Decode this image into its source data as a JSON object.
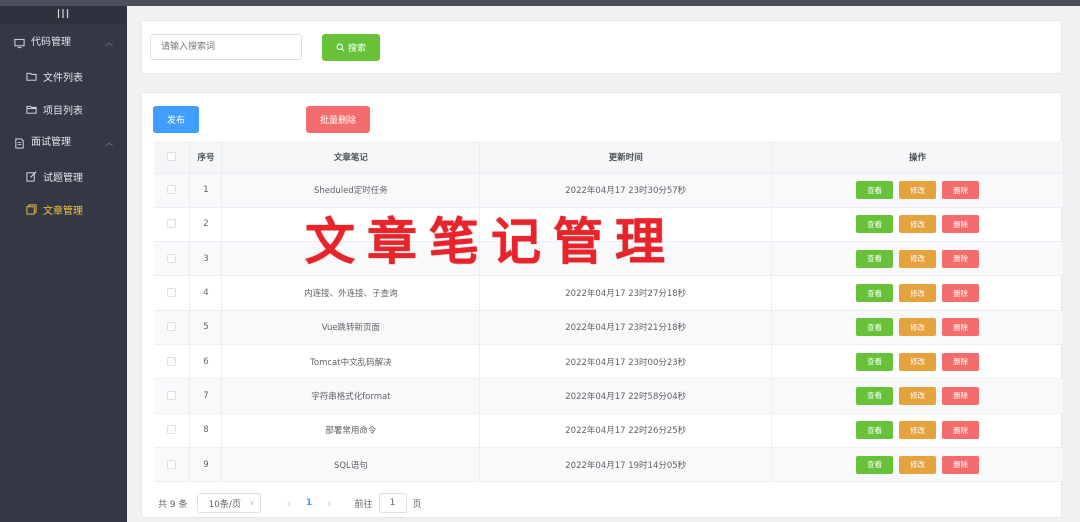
{
  "sidebar": {
    "toggle": "III",
    "groups": [
      {
        "label": "代码管理",
        "items": [
          {
            "label": "文件列表"
          },
          {
            "label": "项目列表"
          }
        ]
      },
      {
        "label": "面试管理",
        "items": [
          {
            "label": "试题管理"
          },
          {
            "label": "文章管理",
            "active": true
          }
        ]
      }
    ]
  },
  "search": {
    "placeholder": "请输入搜索词",
    "button_label": "搜索"
  },
  "toolbar": {
    "publish_label": "发布",
    "batch_delete_label": "批量删除"
  },
  "table": {
    "columns": [
      "序号",
      "文章笔记",
      "更新时间",
      "操作"
    ],
    "rows": [
      {
        "no": "1",
        "title": "Sheduled定时任务",
        "time": "2022年04月17 23时30分57秒"
      },
      {
        "no": "2",
        "title": "",
        "time": ""
      },
      {
        "no": "3",
        "title": "",
        "time": ""
      },
      {
        "no": "4",
        "title": "内连接、外连接、子查询",
        "time": "2022年04月17 23时27分18秒"
      },
      {
        "no": "5",
        "title": "Vue跳转新页面",
        "time": "2022年04月17 23时21分18秒"
      },
      {
        "no": "6",
        "title": "Tomcat中文乱码解决",
        "time": "2022年04月17 23时00分23秒"
      },
      {
        "no": "7",
        "title": "字符串格式化format",
        "time": "2022年04月17 22时58分04秒"
      },
      {
        "no": "8",
        "title": "部署常用命令",
        "time": "2022年04月17 22时26分25秒"
      },
      {
        "no": "9",
        "title": "SQL语句",
        "time": "2022年04月17 19时14分05秒"
      }
    ],
    "actions": {
      "view": "查看",
      "edit": "修改",
      "delete": "删除"
    }
  },
  "pagination": {
    "total": "共 9 条",
    "page_size": "10条/页",
    "current_page": "1",
    "goto_label": "前往",
    "goto_value": "1",
    "page_unit": "页"
  },
  "overlay_title": "文章笔记管理",
  "colors": {
    "sidebar_bg": "#333844",
    "active_menu": "#f6c343",
    "primary": "#409eff",
    "success": "#67c23a",
    "warning": "#e6a23c",
    "danger": "#f56c6c",
    "overlay_text": "#e8232a"
  }
}
